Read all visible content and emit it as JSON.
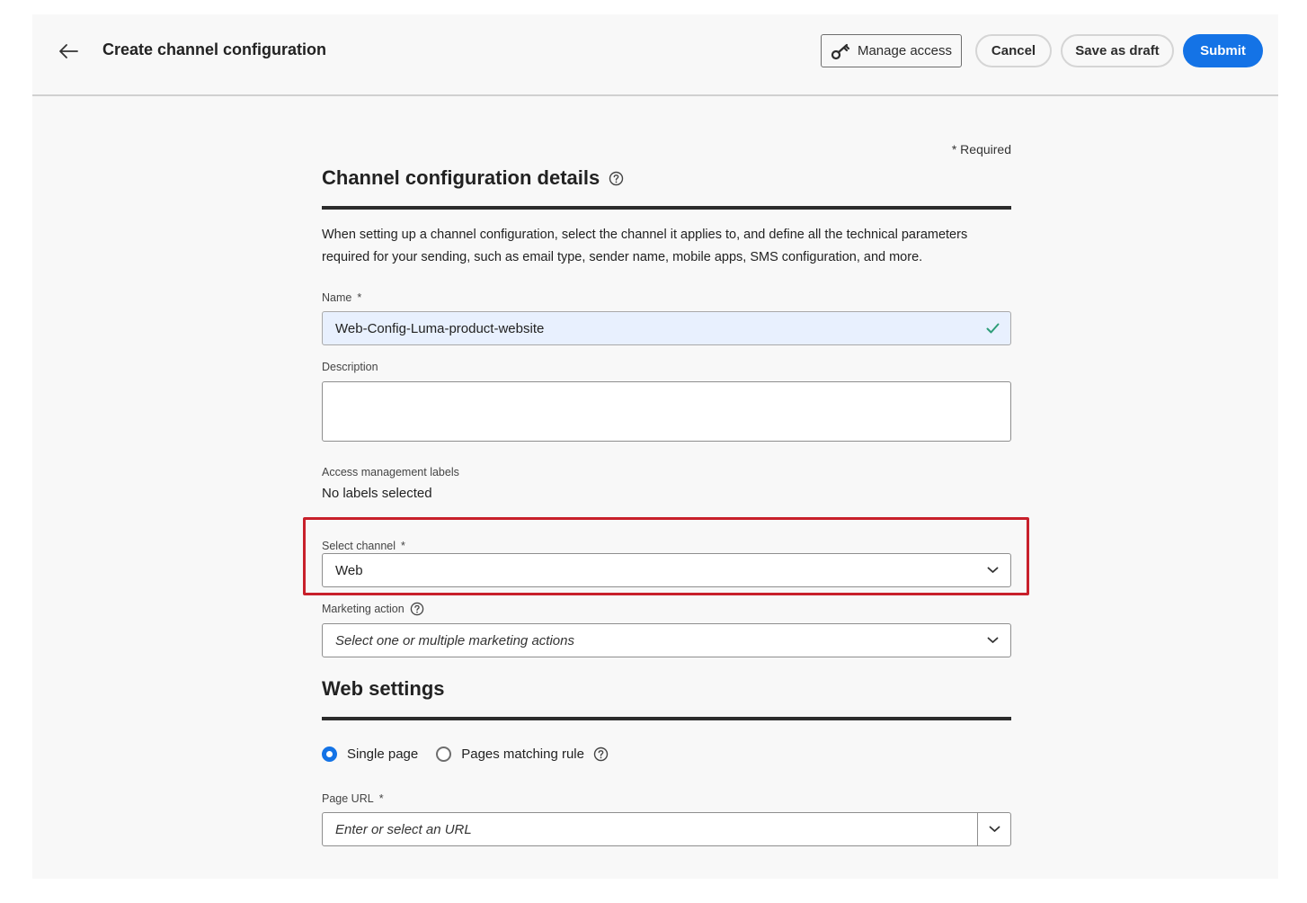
{
  "header": {
    "title": "Create channel configuration",
    "manage_access_label": "Manage access",
    "cancel_label": "Cancel",
    "save_draft_label": "Save as draft",
    "submit_label": "Submit"
  },
  "form": {
    "required_note": "* Required",
    "section_title": "Channel configuration details",
    "description_text": "When setting up a channel configuration, select the channel it applies to, and define all the technical parameters required for your sending, such as email type, sender name, mobile apps, SMS configuration, and more.",
    "name": {
      "label": "Name",
      "required_mark": "*",
      "value": "Web-Config-Luma-product-website"
    },
    "description": {
      "label": "Description",
      "value": ""
    },
    "access_labels": {
      "label": "Access management labels",
      "value": "No labels selected"
    },
    "channel": {
      "label": "Select channel",
      "required_mark": "*",
      "value": "Web"
    },
    "marketing_action": {
      "label": "Marketing action",
      "placeholder": "Select one or multiple marketing actions"
    }
  },
  "web_settings": {
    "title": "Web settings",
    "options": [
      {
        "label": "Single page",
        "selected": true
      },
      {
        "label": "Pages matching rule",
        "selected": false
      }
    ],
    "page_url": {
      "label": "Page URL",
      "required_mark": "*",
      "placeholder": "Enter or select an URL"
    }
  },
  "colors": {
    "accent": "#1473e6",
    "highlight": "#c8202b",
    "valid": "#2d9d78"
  }
}
